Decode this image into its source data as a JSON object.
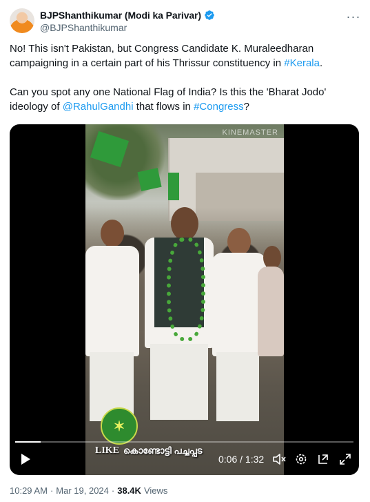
{
  "author": {
    "display_name": "BJPShanthikumar (Modi ka Parivar)",
    "handle": "@BJPShanthikumar",
    "verified": true,
    "avatar_icon": "avatar-icon"
  },
  "menu": {
    "more_icon": "more-options-icon",
    "more_label": "···"
  },
  "tweet": {
    "p1_text": "No! This isn't Pakistan, but Congress Candidate K. Muraleedharan campaigning in a certain part of his Thrissur constituency in ",
    "p1_link": "#Kerala",
    "p1_end": ".",
    "p2_text_a": "Can you spot any one National Flag of India? Is this the 'Bharat Jodo' ideology of ",
    "p2_link_a": "@RahulGandhi",
    "p2_text_b": " that flows in ",
    "p2_link_b": "#Congress",
    "p2_end": "?"
  },
  "video": {
    "watermark": "KINEMASTER",
    "overlay_like": "LIKE",
    "overlay_caption": "കൊണ്ടോട്ടി പച്ചപ്പട",
    "progress": 0.076,
    "time_current": "0:06",
    "time_separator": " / ",
    "time_total": "1:32",
    "controls": [
      "play-icon",
      "volume-muted-icon",
      "settings-icon",
      "pip-icon",
      "fullscreen-icon"
    ]
  },
  "meta": {
    "time": "10:29 AM",
    "dot": "·",
    "date": "Mar 19, 2024",
    "dot2": "·",
    "views_count": "38.4K",
    "views_label": "Views"
  },
  "colors": {
    "link": "#1d9bf0",
    "secondary_text": "#536471",
    "verified_badge": "#1d9bf0"
  }
}
